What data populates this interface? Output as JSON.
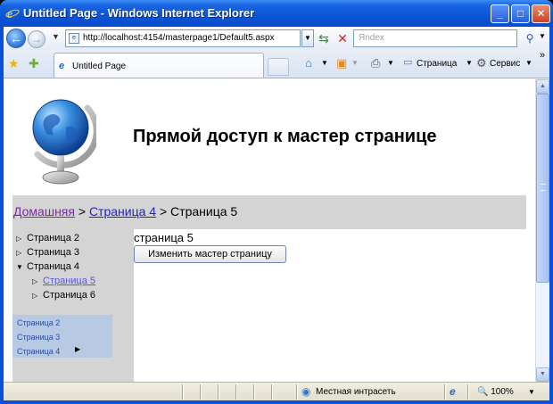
{
  "window": {
    "title": "Untitled Page - Windows Internet Explorer",
    "minimize": "_",
    "maximize": "□",
    "close": "✕"
  },
  "address_bar": {
    "url": "http://localhost:4154/masterpage1/Default5.aspx",
    "search_placeholder": "Яndex"
  },
  "tabs": [
    {
      "label": "Untitled Page"
    }
  ],
  "toolbar": {
    "page_label": "Страница",
    "tools_label": "Сервис",
    "overflow": "»"
  },
  "site": {
    "title": "Прямой доступ к мастер странице"
  },
  "breadcrumb": {
    "home": "Домашняя",
    "sep1": " > ",
    "parent": "Страница 4",
    "sep2": " > ",
    "current": "Страница 5"
  },
  "tree": [
    {
      "label": "Страница 2",
      "expanded": false
    },
    {
      "label": "Страница 3",
      "expanded": false
    },
    {
      "label": "Страница 4",
      "expanded": true
    },
    {
      "label": "Страница 5",
      "link": true
    },
    {
      "label": "Страница 6",
      "expanded": false
    }
  ],
  "menu": [
    {
      "label": "Страница 2"
    },
    {
      "label": "Страница 3"
    },
    {
      "label": "Страница 4"
    }
  ],
  "main": {
    "text": "страница 5",
    "button_label": "Изменить мастер страницу"
  },
  "status": {
    "zone": "Местная интрасеть",
    "zoom": "100%"
  },
  "colors": {
    "titlebar": "#0a55d5",
    "breadcrumb_bg": "#d4d4d4",
    "menu_bg": "#b7c9e3",
    "link": "#2020d0",
    "visited_link": "#7b2a9e"
  }
}
